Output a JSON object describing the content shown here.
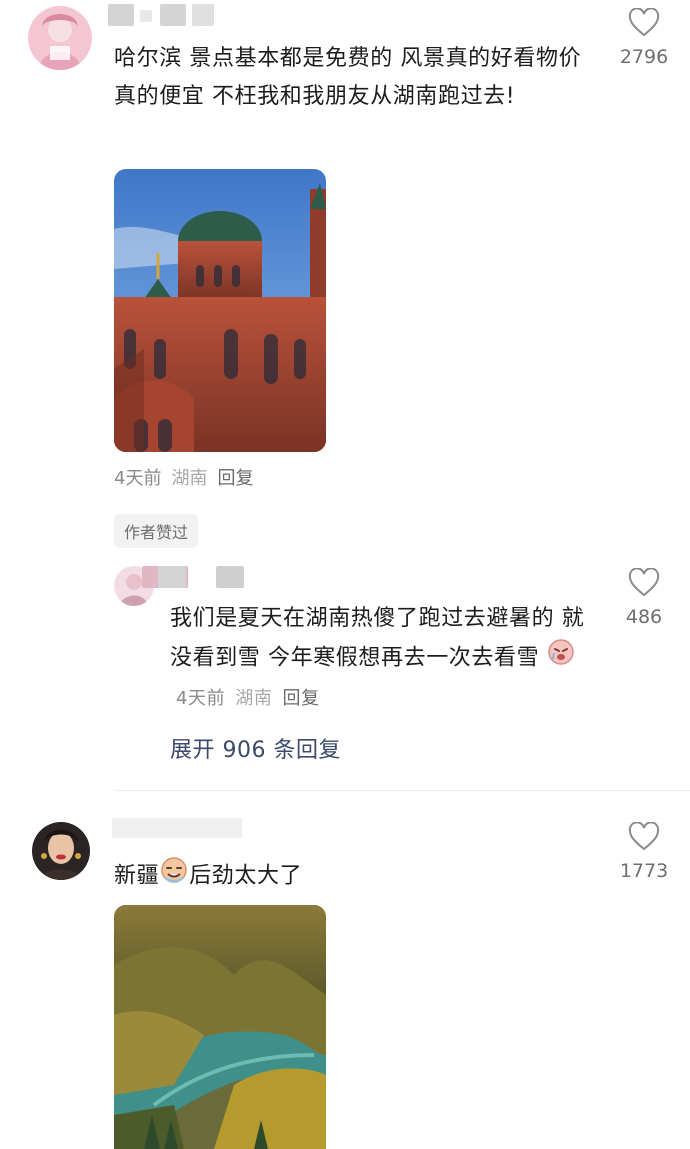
{
  "comments": [
    {
      "text": "哈尔滨 景点基本都是免费的 风景真的好看物价真的便宜 不枉我和我朋友从湖南跑过去!",
      "likes": "2796",
      "time": "4天前",
      "location": "湖南",
      "reply_label": "回复",
      "author_badge": "作者赞过",
      "image_icon": "church-photo"
    },
    {
      "text": "我们是夏天在湖南热傻了跑过去避暑的 就没看到雪 今年寒假想再去一次去看雪",
      "likes": "486",
      "time": "4天前",
      "location": "湖南",
      "reply_label": "回复",
      "emoji_icon": "crying-face-emoji",
      "expand_label": "展开 906 条回复"
    },
    {
      "text_before": "新疆",
      "text_after": "后劲太大了",
      "likes": "1773",
      "emoji_icon": "drooling-face-emoji",
      "image_icon": "forest-lake-photo"
    }
  ],
  "colors": {
    "link": "#3b4a6b",
    "meta": "#8a8a8a",
    "badge_bg": "#f2f2f2"
  }
}
